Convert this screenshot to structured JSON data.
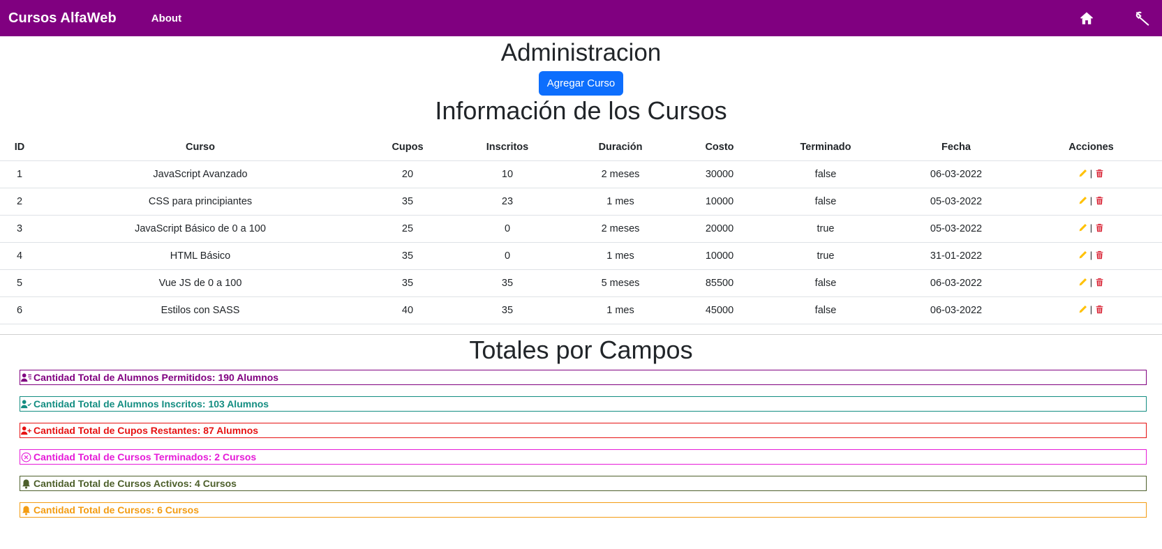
{
  "navbar": {
    "brand": "Cursos AlfaWeb",
    "about": "About",
    "home_icon": "home-icon",
    "tools_icon": "wrench-icon",
    "bg_color": "#800080"
  },
  "admin": {
    "title": "Administracion",
    "add_button": "Agregar Curso"
  },
  "courses": {
    "title": "Información de los Cursos",
    "headers": [
      "ID",
      "Curso",
      "Cupos",
      "Inscritos",
      "Duración",
      "Costo",
      "Terminado",
      "Fecha",
      "Acciones"
    ],
    "rows": [
      {
        "id": "1",
        "curso": "JavaScript Avanzado",
        "cupos": "20",
        "inscritos": "10",
        "duracion": "2 meses",
        "costo": "30000",
        "terminado": "false",
        "fecha": "06-03-2022"
      },
      {
        "id": "2",
        "curso": "CSS para principiantes",
        "cupos": "35",
        "inscritos": "23",
        "duracion": "1 mes",
        "costo": "10000",
        "terminado": "false",
        "fecha": "05-03-2022"
      },
      {
        "id": "3",
        "curso": "JavaScript Básico de 0 a 100",
        "cupos": "25",
        "inscritos": "0",
        "duracion": "2 meses",
        "costo": "20000",
        "terminado": "true",
        "fecha": "05-03-2022"
      },
      {
        "id": "4",
        "curso": "HTML Básico",
        "cupos": "35",
        "inscritos": "0",
        "duracion": "1 mes",
        "costo": "10000",
        "terminado": "true",
        "fecha": "31-01-2022"
      },
      {
        "id": "5",
        "curso": "Vue JS de 0 a 100",
        "cupos": "35",
        "inscritos": "35",
        "duracion": "5 meses",
        "costo": "85500",
        "terminado": "false",
        "fecha": "06-03-2022"
      },
      {
        "id": "6",
        "curso": "Estilos con SASS",
        "cupos": "40",
        "inscritos": "35",
        "duracion": "1 mes",
        "costo": "45000",
        "terminado": "false",
        "fecha": "06-03-2022"
      }
    ],
    "action_separator": "|",
    "edit_icon": "pencil-icon",
    "delete_icon": "trash-icon",
    "edit_color": "#ffc107",
    "delete_color": "#dc3545"
  },
  "totals": {
    "title": "Totales por Campos",
    "items": [
      {
        "text": "Cantidad Total de Alumnos Permitidos: 190 Alumnos",
        "color": "#800080",
        "icon": "person-lines-icon"
      },
      {
        "text": "Cantidad Total de Alumnos Inscritos: 103 Alumnos",
        "color": "#138d81",
        "icon": "person-check-icon"
      },
      {
        "text": "Cantidad Total de Cupos Restantes: 87 Alumnos",
        "color": "#e61212",
        "icon": "person-plus-icon"
      },
      {
        "text": "Cantidad Total de Cursos Terminados: 2 Cursos",
        "color": "#e61ad8",
        "icon": "x-circle-icon"
      },
      {
        "text": "Cantidad Total de Cursos Activos: 4 Cursos",
        "color": "#4d5f2b",
        "icon": "bell-icon"
      },
      {
        "text": "Cantidad Total de Cursos: 6 Cursos",
        "color": "#f39c12",
        "icon": "bell-icon"
      }
    ]
  }
}
